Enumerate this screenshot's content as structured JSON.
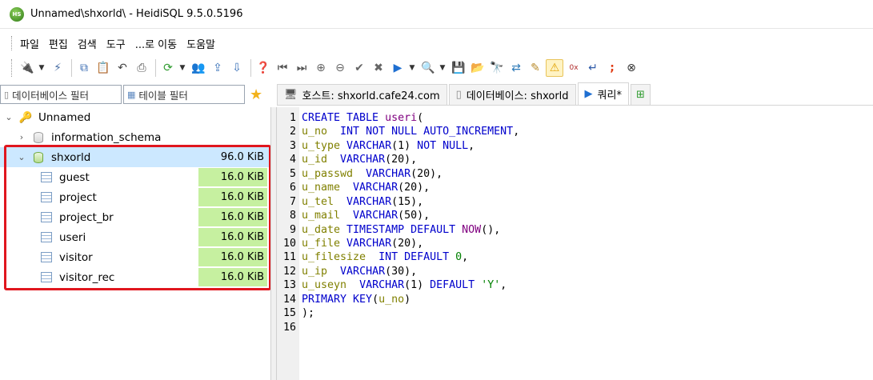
{
  "window": {
    "title": "Unnamed\\shxorld\\ - HeidiSQL 9.5.0.5196",
    "app_icon_text": "HS"
  },
  "menu": [
    "파일",
    "편집",
    "검색",
    "도구",
    "...로 이동",
    "도움말"
  ],
  "toolbar": {
    "buttons": [
      "connect-icon",
      "disconnect-icon",
      "copy-icon",
      "paste-icon",
      "undo-icon",
      "print-icon",
      "refresh-icon",
      "user-manager-icon",
      "export-icon",
      "import-icon",
      "help-icon",
      "first-icon",
      "last-icon",
      "add-icon",
      "remove-icon",
      "check-icon",
      "cancel-icon",
      "run-icon",
      "explain-icon",
      "save-icon",
      "load-icon",
      "binoculars-icon",
      "replace-icon",
      "format-icon",
      "warning-icon",
      "hex-icon",
      "wrap-icon",
      "semicolon-icon",
      "stop-icon"
    ]
  },
  "filters": {
    "database_filter": "데이터베이스 필터",
    "table_filter": "테이블 필터"
  },
  "tabs": [
    {
      "label": "호스트: shxorld.cafe24.com",
      "icon": "host-icon"
    },
    {
      "label": "데이터베이스: shxorld",
      "icon": "database-icon"
    },
    {
      "label": "쿼리*",
      "icon": "query-icon",
      "active": true
    },
    {
      "label": "",
      "icon": "new-tab-icon"
    }
  ],
  "tree": {
    "root": "Unnamed",
    "databases": [
      {
        "name": "information_schema",
        "expanded": false,
        "size": ""
      },
      {
        "name": "shxorld",
        "expanded": true,
        "size": "96.0 KiB",
        "selected": true
      }
    ],
    "tables": [
      {
        "name": "guest",
        "size": "16.0 KiB"
      },
      {
        "name": "project",
        "size": "16.0 KiB"
      },
      {
        "name": "project_br",
        "size": "16.0 KiB"
      },
      {
        "name": "useri",
        "size": "16.0 KiB"
      },
      {
        "name": "visitor",
        "size": "16.0 KiB"
      },
      {
        "name": "visitor_rec",
        "size": "16.0 KiB"
      }
    ]
  },
  "editor": {
    "lines": [
      {
        "n": "1",
        "tokens": [
          [
            "k",
            "CREATE TABLE "
          ],
          [
            "f",
            "useri"
          ],
          [
            "p",
            "("
          ]
        ]
      },
      {
        "n": "2",
        "tokens": [
          [
            "id",
            "u_no  "
          ],
          [
            "k",
            "INT NOT NULL AUTO_INCREMENT"
          ],
          [
            "p",
            ","
          ]
        ]
      },
      {
        "n": "3",
        "tokens": [
          [
            "id",
            "u_type "
          ],
          [
            "k",
            "VARCHAR"
          ],
          [
            "p",
            "(1) "
          ],
          [
            "k",
            "NOT NULL"
          ],
          [
            "p",
            ","
          ]
        ]
      },
      {
        "n": "4",
        "tokens": [
          [
            "id",
            "u_id  "
          ],
          [
            "k",
            "VARCHAR"
          ],
          [
            "p",
            "(20),"
          ]
        ]
      },
      {
        "n": "5",
        "tokens": [
          [
            "id",
            "u_passwd  "
          ],
          [
            "k",
            "VARCHAR"
          ],
          [
            "p",
            "(20),"
          ]
        ]
      },
      {
        "n": "6",
        "tokens": [
          [
            "id",
            "u_name  "
          ],
          [
            "k",
            "VARCHAR"
          ],
          [
            "p",
            "(20),"
          ]
        ]
      },
      {
        "n": "7",
        "tokens": [
          [
            "id",
            "u_tel  "
          ],
          [
            "k",
            "VARCHAR"
          ],
          [
            "p",
            "(15),"
          ]
        ]
      },
      {
        "n": "8",
        "tokens": [
          [
            "id",
            "u_mail  "
          ],
          [
            "k",
            "VARCHAR"
          ],
          [
            "p",
            "(50),"
          ]
        ]
      },
      {
        "n": "9",
        "tokens": [
          [
            "id",
            "u_date "
          ],
          [
            "k",
            "TIMESTAMP DEFAULT "
          ],
          [
            "f",
            "NOW"
          ],
          [
            "p",
            "(),"
          ]
        ]
      },
      {
        "n": "10",
        "tokens": [
          [
            "id",
            "u_file "
          ],
          [
            "k",
            "VARCHAR"
          ],
          [
            "p",
            "(20),"
          ]
        ]
      },
      {
        "n": "11",
        "tokens": [
          [
            "id",
            "u_filesize  "
          ],
          [
            "k",
            "INT DEFAULT "
          ],
          [
            "n",
            "0"
          ],
          [
            "p",
            ","
          ]
        ]
      },
      {
        "n": "12",
        "tokens": [
          [
            "id",
            "u_ip  "
          ],
          [
            "k",
            "VARCHAR"
          ],
          [
            "p",
            "(30),"
          ]
        ]
      },
      {
        "n": "13",
        "tokens": [
          [
            "id",
            "u_useyn  "
          ],
          [
            "k",
            "VARCHAR"
          ],
          [
            "p",
            "(1) "
          ],
          [
            "k",
            "DEFAULT "
          ],
          [
            "s",
            "'Y'"
          ],
          [
            "p",
            ","
          ]
        ]
      },
      {
        "n": "14",
        "tokens": [
          [
            "k",
            "PRIMARY KEY"
          ],
          [
            "p",
            "("
          ],
          [
            "id",
            "u_no"
          ],
          [
            "p",
            ")"
          ]
        ]
      },
      {
        "n": "15",
        "tokens": [
          [
            "p",
            ");"
          ]
        ]
      },
      {
        "n": "16",
        "tokens": []
      }
    ]
  },
  "colors": {
    "highlight_border": "#e0161e",
    "size_bar": "#c6f0a0",
    "selected_row": "#cce8ff",
    "keyword": "#0000cc"
  }
}
